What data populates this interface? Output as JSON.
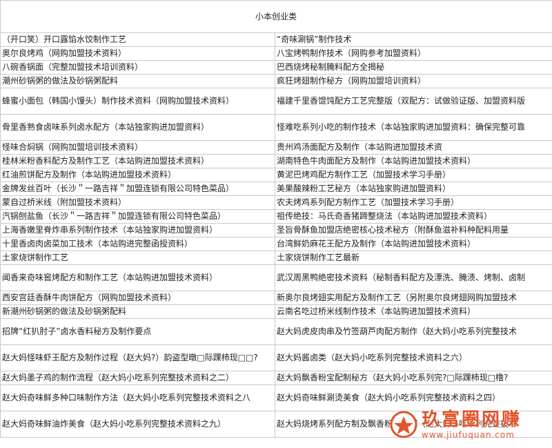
{
  "title": "小本创业类",
  "rows": [
    [
      "（开口笑）开口露馅水饺制作工艺",
      "“奇味涮锅”制作技术"
    ],
    [
      "奥尔良烤鸡（网购加盟技术资料）",
      "八宝烤鸭制作技术（网购参考加盟资料）"
    ],
    [
      "八碗香锅面（完整加盟技术培训资料）",
      "巴西烧烤秘制腌料配方全揭秘"
    ],
    [
      "潮州砂锅粥的做法及砂锅粥配料",
      "疯狂烤翅制作秘方（网购加盟培训资料）"
    ],
    [
      "蜂蜜小面包（韩国小馒头）制作技术资料（网购加盟技术资料）",
      "福建千里香馄饨配方工艺完整版（双配方：试做验证版、加盟资料版"
    ],
    [
      "骨里香熟食卤味系列卤水配方（本站独家购进加盟资料）",
      "怪难吃系列小吃的制作技术（本站独家购进加盟资料：确保完整可靠"
    ],
    [
      "怪味合焖锅（网购加盟培训技术资料）",
      "贵州鸡汤面配方及制作（本站购进加盟技术资"
    ],
    [
      "桂林米粉香料配方及制作工艺（本站购进加盟技术资料）",
      "湖南特色牛肉面配方及制作（本站购进加盟技术资料）"
    ],
    [
      "红油煎饼配方及制作（本站购进加盟技术资料）",
      "黄泥巴烤鸡配方制作工艺（加盟技术学习手册）"
    ],
    [
      "金牌发丝百叶（长沙＂一路吉祥＂加盟连锁有限公司特色菜品）",
      "美果酸辣粉工艺秘方（本站独家购进加盟资料）"
    ],
    [
      "蒙自过桥米线（附加盟技术资料）",
      "农夫烤鸡系列配方制作工艺（加盟技术学习手册）"
    ],
    [
      "汽锅刨盐鱼（长沙＂一路吉祥＂加盟连锁有限公司特色菜品）",
      "祖传绝技：马氏奇香猪蹄整烧法（本站购进加盟技术资料）"
    ],
    [
      "上海香嫩里脊炸串系列制作技术（本站独家购进加盟资料）",
      "圣旨骨酥鱼加盟店绝密核心技术秘方（附酥鱼滋补料种配料用量"
    ],
    [
      "十里香卤肉卤菜加工技术（本站购进完整函授资料）",
      "台湾鲜奶麻花王配方及制作（本站购进加盟技术资料）"
    ],
    [
      "土家烧饼制作工艺",
      "土家烧饼制作工艺最新"
    ],
    [
      "闻香来奇味窖烤配方和制作工艺（本站购进加盟技术资料）",
      "武汉周黑鸭绝密技术资料（秘制香料配方及漂洗、腌渍、烤制、卤制"
    ],
    [
      "西安宫廷香酥牛肉饼配方（网购加盟技术资料）",
      "新奥尔良烤翅实用配方及制作工艺（另附奥尔良烤翅网购加盟技术"
    ],
    [
      "新潮州砂锅粥的做法及砂锅粥配料",
      "云南名吃过桥米线制作技术（本站购进加盟技术资料）"
    ],
    [
      "招牌“红扒肘子”卤水香料秘方及制作要点",
      "赵大妈虎皮肉串及竹签葫芦肉配方制作（赵大妈小吃系列完整技术"
    ],
    [
      "赵大妈怪味虾王配方及制作过程（赵大妈?）韵盗型暾□际踝柿现□□?",
      "赵大妈酱卤类（赵大妈小吃系列完整技术资料之六）"
    ],
    [
      "赵大妈墨子鸡的制作流程（赵大妈小吃系列完整技术资料之二）",
      "赵大妈飘香粉宝配制秘方（赵大妈小吃系列完?□际踝柿现□橹?"
    ],
    [
      "赵大妈奇味鲜多种口味制作方法（赵大妈小吃系列完整技术资料之八",
      "赵大妈奇味鲜涮烫美食（赵大妈小吃系列完整技术资料之四）"
    ],
    [
      "赵大妈奇味鲜油炸美食（赵大妈小吃系列完整技术资料之九）",
      "赵大妈烧烤系列配方制及飘香粉宝配制（赵大妈小吃系列完整技术"
    ]
  ],
  "watermark": {
    "cn": "玖富圈网赚",
    "url": "www.jiufuquan.com",
    "logo_color": "#e1532b"
  }
}
